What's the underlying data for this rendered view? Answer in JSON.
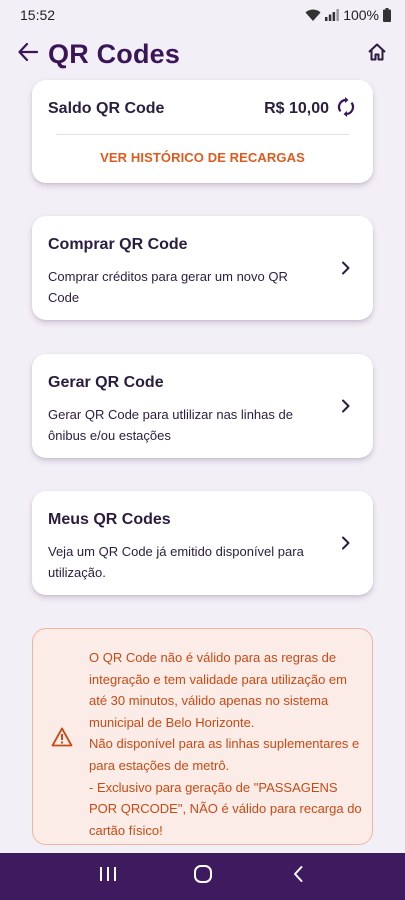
{
  "status_bar": {
    "time": "15:52",
    "battery_percent": "100%",
    "icons": [
      "wifi-icon",
      "signal-icon",
      "battery-icon"
    ]
  },
  "header": {
    "title": "QR Codes",
    "back_icon": "arrow-left-icon",
    "home_icon": "home-icon"
  },
  "balance_card": {
    "label": "Saldo QR Code",
    "value": "R$ 10,00",
    "refresh_icon": "refresh-icon",
    "history_link": "VER HISTÓRICO DE RECARGAS"
  },
  "actions": [
    {
      "title": "Comprar QR Code",
      "description": "Comprar créditos para gerar um novo QR Code",
      "icon": "chevron-right-icon"
    },
    {
      "title": "Gerar QR Code",
      "description": "Gerar QR Code para utlilizar nas linhas de ônibus e/ou estações",
      "icon": "chevron-right-icon"
    },
    {
      "title": "Meus QR Codes",
      "description": "Veja um QR Code já emitido disponível para utilização.",
      "icon": "chevron-right-icon"
    }
  ],
  "warning": {
    "icon": "warning-triangle-icon",
    "line1": "O QR Code não é válido para as regras de integração e tem validade para utilização em até 30 minutos, válido apenas no sistema municipal de Belo Horizonte.",
    "line2": "Não disponível para as linhas suplementares e para estações de metrô.",
    "line3": "- Exclusivo para geração de \"PASSAGENS POR QRCODE\", NÃO é válido para recarga do cartão físico!"
  },
  "nav_bar": {
    "icons": [
      "recent-apps-icon",
      "home-circle-icon",
      "back-chevron-icon"
    ]
  },
  "colors": {
    "title_purple": "#3a1659",
    "accent_orange": "#e05a1f",
    "warning_bg": "#fbece8",
    "warning_border": "#f2b3a0",
    "nav_bar": "#3e1b5e",
    "background": "#f3eff6"
  }
}
